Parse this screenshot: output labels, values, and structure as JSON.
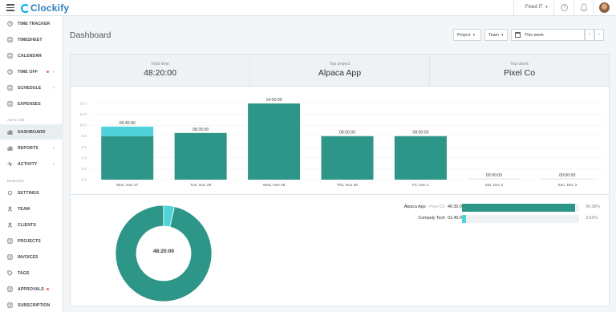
{
  "app": {
    "name": "Clockify"
  },
  "header": {
    "workspace": "Fixed IT",
    "workspace_caret": "▾",
    "help_icon": "?"
  },
  "sidebar": {
    "items_top": [
      {
        "label": "TIME TRACKER",
        "icon": "clock-icon"
      },
      {
        "label": "TIMESHEET",
        "icon": "timesheet-icon"
      },
      {
        "label": "CALENDAR",
        "icon": "calendar-icon"
      },
      {
        "label": "TIME OFF",
        "icon": "time-off-icon",
        "dot": true,
        "chevron": "›"
      },
      {
        "label": "SCHEDULE",
        "icon": "schedule-icon",
        "chevron": "›"
      },
      {
        "label": "EXPENSES",
        "icon": "expenses-icon"
      }
    ],
    "analyze_label": "ANALYZE",
    "items_analyze": [
      {
        "label": "DASHBOARD",
        "icon": "dashboard-icon",
        "active": true
      },
      {
        "label": "REPORTS",
        "icon": "reports-icon",
        "chevron": "›"
      },
      {
        "label": "ACTIVITY",
        "icon": "activity-icon",
        "chevron": "›"
      }
    ],
    "manage_label": "MANAGE",
    "items_manage": [
      {
        "label": "SETTINGS",
        "icon": "settings-icon"
      },
      {
        "label": "TEAM",
        "icon": "team-icon"
      },
      {
        "label": "CLIENTS",
        "icon": "clients-icon"
      },
      {
        "label": "PROJECTS",
        "icon": "projects-icon"
      },
      {
        "label": "INVOICES",
        "icon": "invoices-icon"
      },
      {
        "label": "TAGS",
        "icon": "tags-icon"
      },
      {
        "label": "APPROVALS",
        "icon": "approvals-icon",
        "dot": true
      },
      {
        "label": "SUBSCRIPTION",
        "icon": "subscription-icon"
      }
    ]
  },
  "main": {
    "title": "Dashboard",
    "filters": {
      "project": "Project",
      "team": "Team",
      "caret": "▾",
      "date": "This week",
      "prev": "‹",
      "next": "›"
    },
    "summary": [
      {
        "label": "Total time",
        "value": "48:20:00"
      },
      {
        "label": "Top project",
        "value": "Alpaca App"
      },
      {
        "label": "Top client",
        "value": "Pixel Co"
      }
    ],
    "donut_total": "48:20:00",
    "breakdown": [
      {
        "project": "Alpaca App",
        "client": "Pixel Co",
        "time": "46:35:00",
        "percent": "96.38%",
        "fraction": 0.9638,
        "color": "#2e9688"
      },
      {
        "project": "Compuly Tech",
        "client": "",
        "time": "01:45:00",
        "percent": "3.62%",
        "fraction": 0.0362,
        "color": "#4fd3db"
      }
    ]
  },
  "chart_data": {
    "type": "bar",
    "categories": [
      "Mon, Nov 27",
      "Tue, Nov 28",
      "Wed, Nov 29",
      "Thu, Nov 30",
      "Fri, Dec 1",
      "Sat, Dec 2",
      "Sun, Dec 3"
    ],
    "totals_labels": [
      "09:45:00",
      "08:35:00",
      "14:00:00",
      "08:00:00",
      "08:00:00",
      "00:00:00",
      "00:00:00"
    ],
    "series": [
      {
        "values": [
          8,
          8.58,
          14,
          8,
          8,
          0,
          0
        ],
        "color": "#2e9688"
      },
      {
        "values": [
          1.75,
          0,
          0,
          0,
          0,
          0,
          0
        ],
        "color": "#4fd3db"
      }
    ],
    "ylim": [
      0,
      14
    ],
    "yticks": [
      "0.0",
      "2.0",
      "4.0",
      "6.0",
      "8.0",
      "10.0",
      "12.0",
      "14.0"
    ],
    "grid": true,
    "stacked": true
  }
}
